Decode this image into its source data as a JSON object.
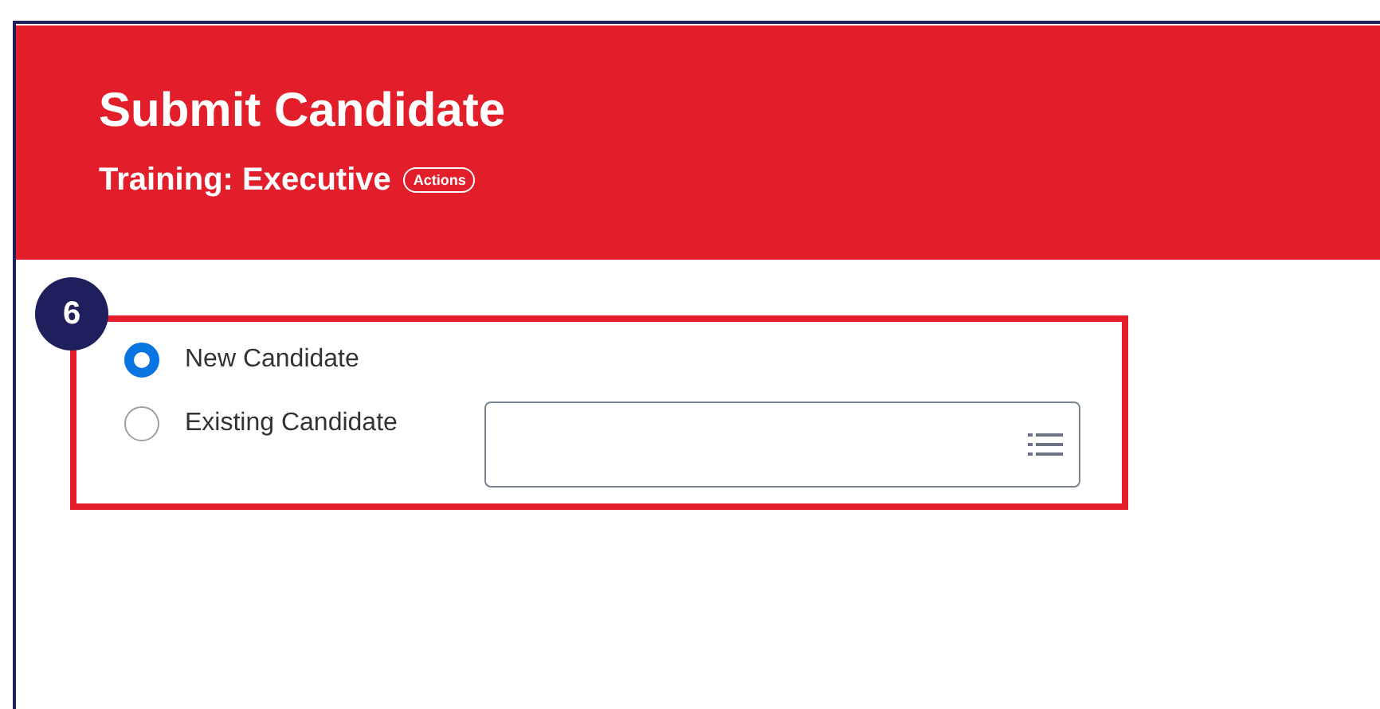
{
  "header": {
    "title": "Submit Candidate",
    "subtitle": "Training: Executive",
    "actions_button": "Actions"
  },
  "step_badge": "6",
  "options": [
    {
      "kind": "plain",
      "label": "New Candidate",
      "selected": true
    },
    {
      "kind": "with_field",
      "label": "Existing Candidate",
      "selected": false
    }
  ]
}
